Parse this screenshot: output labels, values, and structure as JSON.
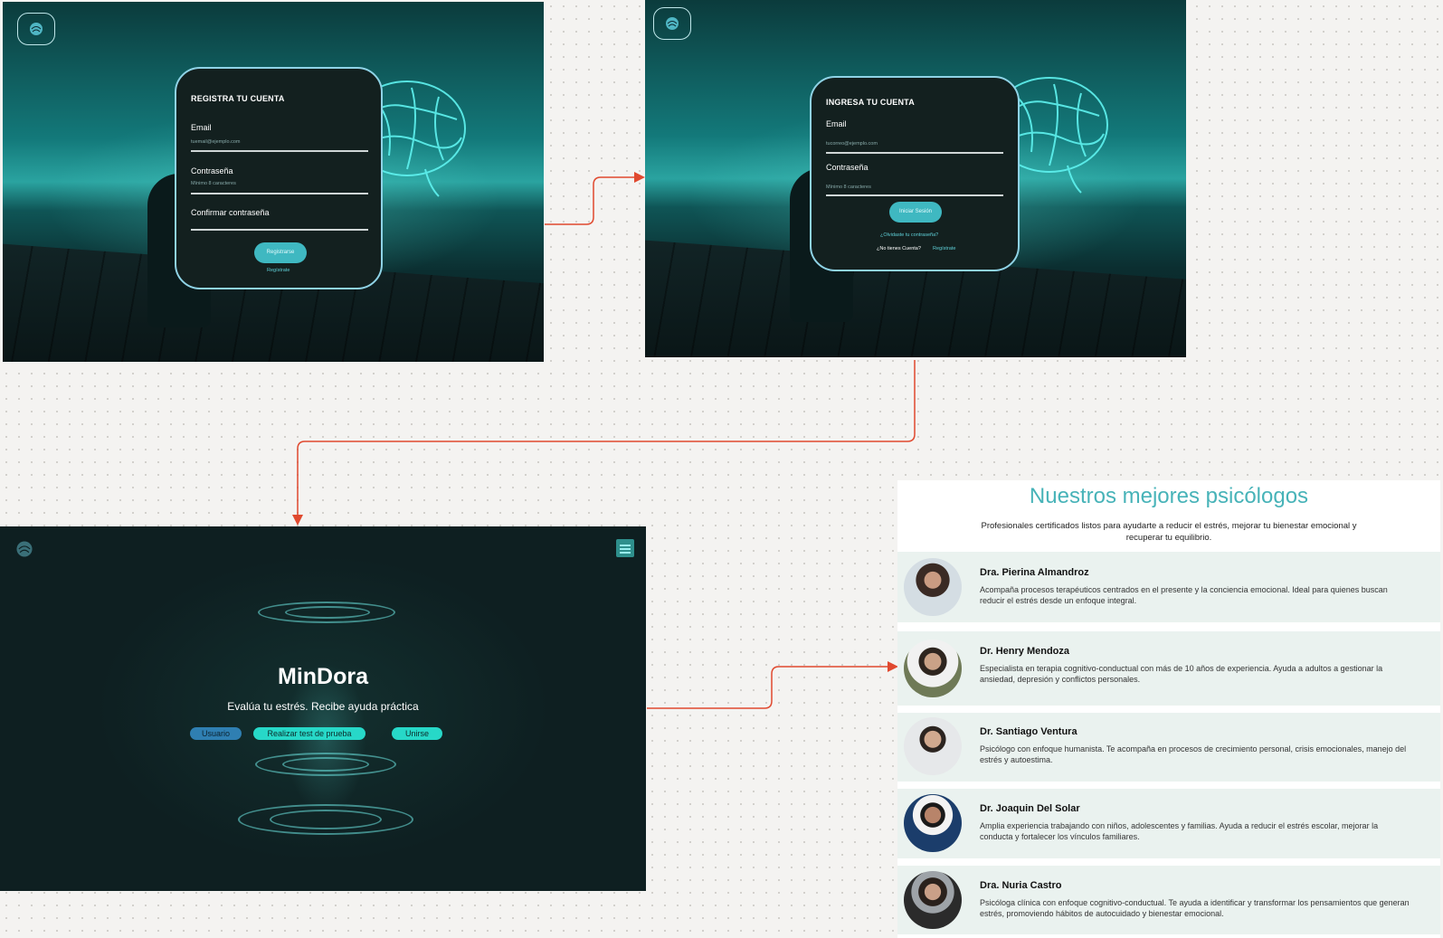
{
  "register": {
    "title": "REGISTRA TU CUENTA",
    "email_label": "Email",
    "email_placeholder": "tuemail@ejemplo.com",
    "password_label": "Contraseña",
    "password_placeholder": "Mínimo 8 caracteres",
    "confirm_label": "Confirmar contraseña",
    "submit": "Registrarse",
    "link": "Regístrate"
  },
  "login": {
    "title": "INGRESA TU CUENTA",
    "email_label": "Email",
    "email_placeholder": "tucorreo@ejemplo.com",
    "password_label": "Contraseña",
    "password_placeholder": "Mínimo 8 caracteres",
    "submit": "Iniciar Sesión",
    "forgot": "¿Olvidaste tu contraseña?",
    "no_account": "¿No tienes Cuenta?",
    "signup": "Regístrate"
  },
  "hero": {
    "title": "MinDora",
    "subtitle": "Evalúa tu estrés. Recibe ayuda práctica",
    "btn_user": "Usuario",
    "btn_test": "Realizar test de prueba",
    "btn_join": "Unirse"
  },
  "psychologists": {
    "title": "Nuestros mejores psicólogos",
    "subtitle_line1": "Profesionales certificados listos para ayudarte a reducir el estrés, mejorar tu bienestar emocional y",
    "subtitle_line2": "recuperar tu equilibrio.",
    "items": [
      {
        "name": "Dra. Pierina Almandroz",
        "d1": "Acompaña procesos terapéuticos centrados en el presente y la conciencia emocional. Ideal para quienes buscan",
        "d2": "reducir el estrés desde un enfoque integral."
      },
      {
        "name": "Dr. Henry Mendoza",
        "d1": "Especialista en terapia cognitivo-conductual con más de 10 años de experiencia. Ayuda a adultos a gestionar la",
        "d2": "ansiedad, depresión y conflictos personales."
      },
      {
        "name": "Dr. Santiago Ventura",
        "d1": "Psicólogo con enfoque humanista. Te acompaña en procesos de crecimiento personal, crisis emocionales, manejo del",
        "d2": "estrés y autoestima."
      },
      {
        "name": "Dr. Joaquin Del Solar",
        "d1": "Amplia experiencia trabajando con niños, adolescentes y familias. Ayuda a reducir el estrés escolar, mejorar la",
        "d2": "conducta y fortalecer los vínculos familiares."
      },
      {
        "name": "Dra. Nuria Castro",
        "d1": "Psicóloga clínica con enfoque cognitivo-conductual. Te ayuda a identificar y transformar los pensamientos que generan",
        "d2": "estrés, promoviendo hábitos de autocuidado y bienestar emocional."
      }
    ]
  },
  "colors": {
    "accent": "#47b3b8",
    "arrow": "#e0492f",
    "card_border": "#8fd3e6"
  }
}
